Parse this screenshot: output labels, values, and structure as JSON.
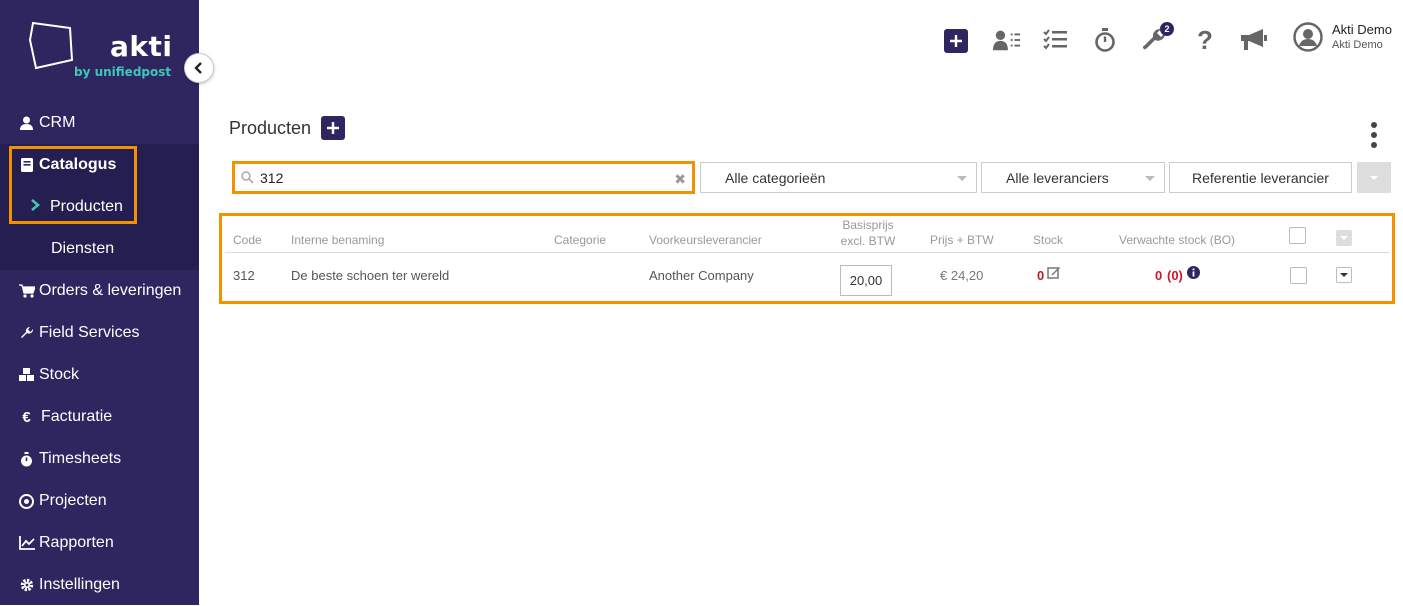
{
  "brand": {
    "name": "akti",
    "tagline": "by unifiedpost",
    "logo_icon": "akti-logo",
    "accent": "#3ec7b7",
    "sidebar_bg": "#2f2660",
    "highlight": "#f39200"
  },
  "sidebar": {
    "items": [
      {
        "label": "CRM",
        "icon": "user-icon"
      },
      {
        "label": "Catalogus",
        "icon": "book-icon"
      },
      {
        "label": "Producten",
        "icon": "chevron-right-icon"
      },
      {
        "label": "Diensten"
      },
      {
        "label": "Orders & leveringen",
        "icon": "cart-icon"
      },
      {
        "label": "Field Services",
        "icon": "wrench-icon"
      },
      {
        "label": "Stock",
        "icon": "cubes-icon"
      },
      {
        "label": "Facturatie",
        "icon": "euro-icon"
      },
      {
        "label": "Timesheets",
        "icon": "stopwatch-icon"
      },
      {
        "label": "Projecten",
        "icon": "target-icon"
      },
      {
        "label": "Rapporten",
        "icon": "line-chart-icon"
      },
      {
        "label": "Instellingen",
        "icon": "cog-icon"
      }
    ]
  },
  "topbar": {
    "wrench_badge": "2",
    "user_name": "Akti Demo",
    "user_company": "Akti Demo"
  },
  "page": {
    "title": "Producten"
  },
  "filters": {
    "search_value": "312",
    "category": "Alle categorieën",
    "supplier": "Alle leveranciers",
    "reference": "Referentie leverancier"
  },
  "table": {
    "headers": {
      "code": "Code",
      "name": "Interne benaming",
      "category": "Categorie",
      "supplier": "Voorkeursleverancier",
      "base_price_1": "Basisprijs",
      "base_price_2": "excl. BTW",
      "price_vat": "Prijs + BTW",
      "stock": "Stock",
      "expected_stock": "Verwachte stock (BO)"
    },
    "rows": [
      {
        "code": "312",
        "name": "De beste schoen ter wereld",
        "category": "",
        "supplier": "Another Company",
        "base_price": "20,00",
        "price_vat": "€ 24,20",
        "stock": "0",
        "expected_stock": "0",
        "backorder": "(0)"
      }
    ]
  }
}
